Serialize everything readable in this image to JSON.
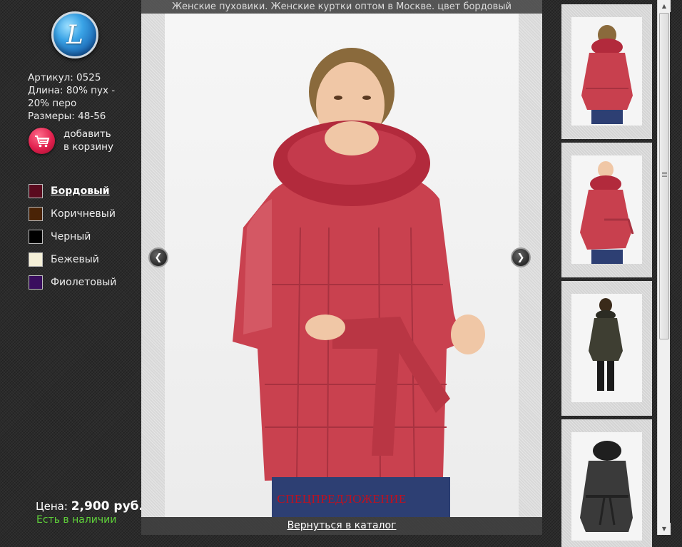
{
  "logo": {
    "letter": "L"
  },
  "product": {
    "article": "Артикул: 0525",
    "length_line1": "Длина: 80% пух -",
    "length_line2": "20% перо",
    "sizes": "Размеры: 48-56"
  },
  "cart": {
    "line1": "добавить",
    "line2": "в корзину",
    "icon": "shopping-cart-icon"
  },
  "colors": [
    {
      "label": "Бордовый",
      "hex": "#5a0a1e",
      "active": true
    },
    {
      "label": "Коричневый",
      "hex": "#4a2306"
    },
    {
      "label": "Черный",
      "hex": "#000000"
    },
    {
      "label": "Бежевый",
      "hex": "#f5f0d8"
    },
    {
      "label": "Фиолетовый",
      "hex": "#3a0e5e"
    }
  ],
  "pricing": {
    "label": "Цена:",
    "value": "2,900 руб.",
    "stock": "Есть в наличии",
    "stock_color": "#5fd13a"
  },
  "viewer": {
    "title": "Женские пуховики. Женские куртки оптом в Москве. цвет бордовый",
    "special": "СПЕЦПРЕДЛОЖЕНИЕ",
    "back": "Вернуться в каталог",
    "prev_icon": "chevron-left-icon",
    "next_icon": "chevron-right-icon"
  },
  "thumbnails": [
    {
      "jacket": "#c8404e",
      "view": "back"
    },
    {
      "jacket": "#c8404e",
      "view": "front"
    },
    {
      "jacket": "#3e3e32",
      "view": "full"
    },
    {
      "jacket": "#3a3a3a",
      "view": "front"
    }
  ],
  "colors_meta": {
    "accent_red": "#c0101f",
    "jacket_red": "#c9414f"
  }
}
